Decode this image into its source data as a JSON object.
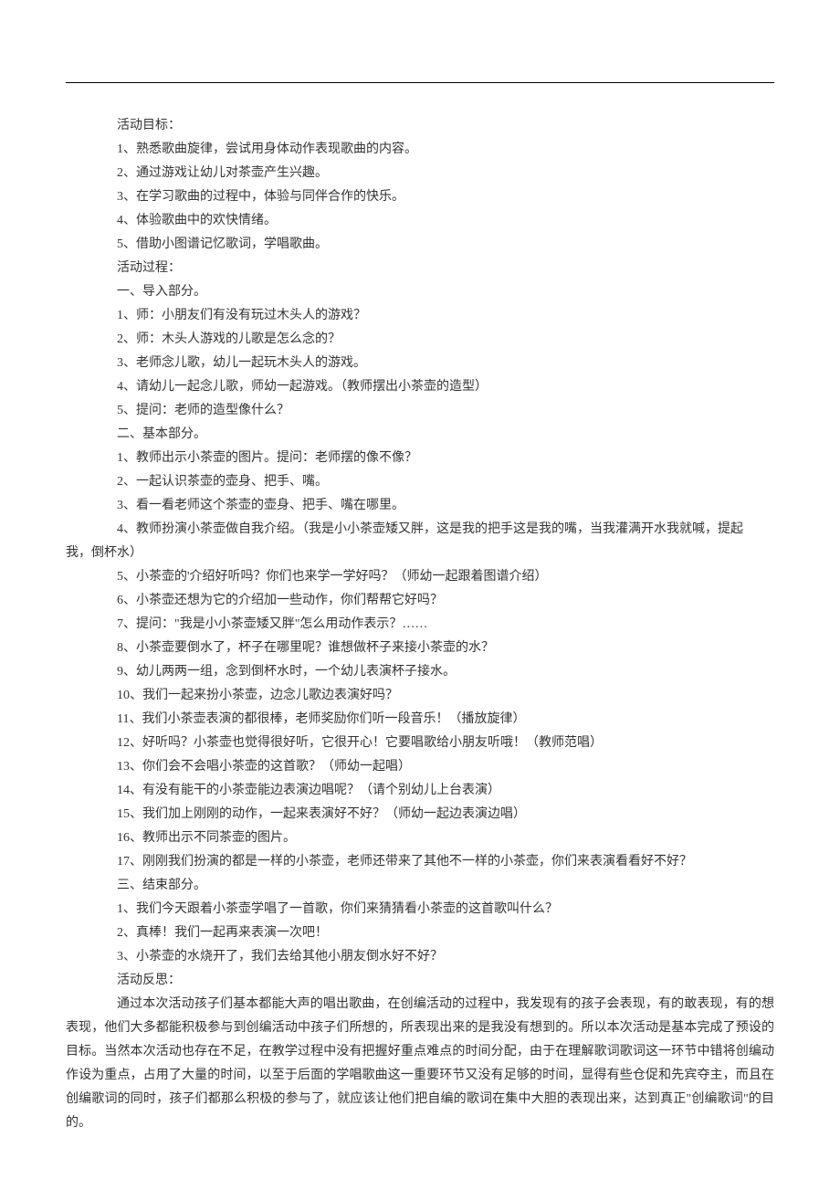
{
  "sections": {
    "goals_title": "活动目标：",
    "goals": [
      "1、熟悉歌曲旋律，尝试用身体动作表现歌曲的内容。",
      "2、通过游戏让幼儿对茶壶产生兴趣。",
      "3、在学习歌曲的过程中，体验与同伴合作的快乐。",
      "4、体验歌曲中的欢快情绪。",
      "5、借助小图谱记忆歌词，学唱歌曲。"
    ],
    "process_title": "活动过程：",
    "part1_title": "一、导入部分。",
    "part1": [
      "1、师：小朋友们有没有玩过木头人的游戏？",
      "2、师：木头人游戏的儿歌是怎么念的？",
      "3、老师念儿歌，幼儿一起玩木头人的游戏。",
      "4、请幼儿一起念儿歌，师幼一起游戏。（教师摆出小茶壶的造型）",
      "5、提问：老师的造型像什么？"
    ],
    "part2_title": "二、基本部分。",
    "part2_a": [
      "1、教师出示小茶壶的图片。提问：老师摆的像不像？",
      "2、一起认识茶壶的壶身、把手、嘴。",
      "3、看一看老师这个茶壶的壶身、把手、嘴在哪里。"
    ],
    "part2_4_prefix": "4、教师扮演小茶壶做自我介绍。（我是小小茶壶矮又胖，这是我的把手这是我的嘴，当我灌满开水我就喊，提起",
    "part2_4_suffix": "我，倒杯水）",
    "part2_b": [
      "5、小茶壶的'介绍好听吗？你们也来学一学好吗？（师幼一起跟着图谱介绍）",
      "6、小茶壶还想为它的介绍加一些动作，你们帮帮它好吗？",
      "7、提问：\"我是小小茶壶矮又胖\"怎么用动作表示？……",
      "8、小茶壶要倒水了，杯子在哪里呢？谁想做杯子来接小茶壶的水？",
      "9、幼儿两两一组，念到倒杯水时，一个幼儿表演杯子接水。",
      "10、我们一起来扮小茶壶，边念儿歌边表演好吗？",
      "11、我们小茶壶表演的都很棒，老师奖励你们听一段音乐！（播放旋律）",
      "12、好听吗？小茶壶也觉得很好听，它很开心！它要唱歌给小朋友听哦！（教师范唱）",
      "13、你们会不会唱小茶壶的这首歌？（师幼一起唱）",
      "14、有没有能干的小茶壶能边表演边唱呢？（请个别幼儿上台表演）",
      "15、我们加上刚刚的动作，一起来表演好不好？（师幼一起边表演边唱）",
      "16、教师出示不同茶壶的图片。",
      "17、刚刚我们扮演的都是一样的小茶壶，老师还带来了其他不一样的小茶壶，你们来表演看看好不好？"
    ],
    "part3_title": "三、结束部分。",
    "part3": [
      "1、我们今天跟着小茶壶学唱了一首歌，你们来猜猜看小茶壶的这首歌叫什么？",
      "2、真棒！我们一起再来表演一次吧！",
      "3、小茶壶的水烧开了，我们去给其他小朋友倒水好不好？"
    ],
    "reflection_title": "活动反思：",
    "reflection_body": "通过本次活动孩子们基本都能大声的唱出歌曲，在创编活动的过程中，我发现有的孩子会表现，有的敢表现，有的想表现，他们大多都能积极参与到创编活动中孩子们所想的，所表现出来的是我没有想到的。所以本次活动是基本完成了预设的目标。当然本次活动也存在不足，在教学过程中没有把握好重点难点的时间分配，由于在理解歌词歌词这一环节中错将创编动作设为重点，占用了大量的时间，以至于后面的学唱歌曲这一重要环节又没有足够的时间，显得有些仓促和先宾夺主，而且在创编歌词的同时，孩子们都那么积极的参与了，就应该让他们把自编的歌词在集中大胆的表现出来，达到真正\"创编歌词\"的目的。"
  }
}
